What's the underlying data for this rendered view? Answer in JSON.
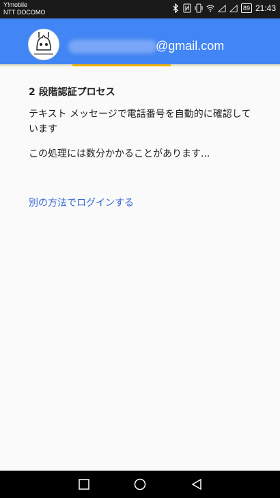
{
  "status_bar": {
    "carrier_1": "Y!mobile",
    "carrier_2": "NTT DOCOMO",
    "battery": "89",
    "time": "21:43"
  },
  "account": {
    "email_domain": "@gmail.com"
  },
  "progress": {
    "fraction": 0.35
  },
  "content": {
    "title": "2 段階認証プロセス",
    "description": "テキスト メッセージで電話番号を自動的に確認しています",
    "wait_message": "この処理には数分かかることがあります...",
    "alternate_link": "別の方法でログインする"
  },
  "colors": {
    "header_blue": "#4285f4",
    "progress_yellow": "#f4b400",
    "link_blue": "#3367d6"
  },
  "icons": [
    "bluetooth-icon",
    "nfc-icon",
    "vibrate-icon",
    "wifi-icon",
    "signal-icon",
    "battery-icon",
    "recent-apps-icon",
    "home-icon",
    "back-icon"
  ]
}
